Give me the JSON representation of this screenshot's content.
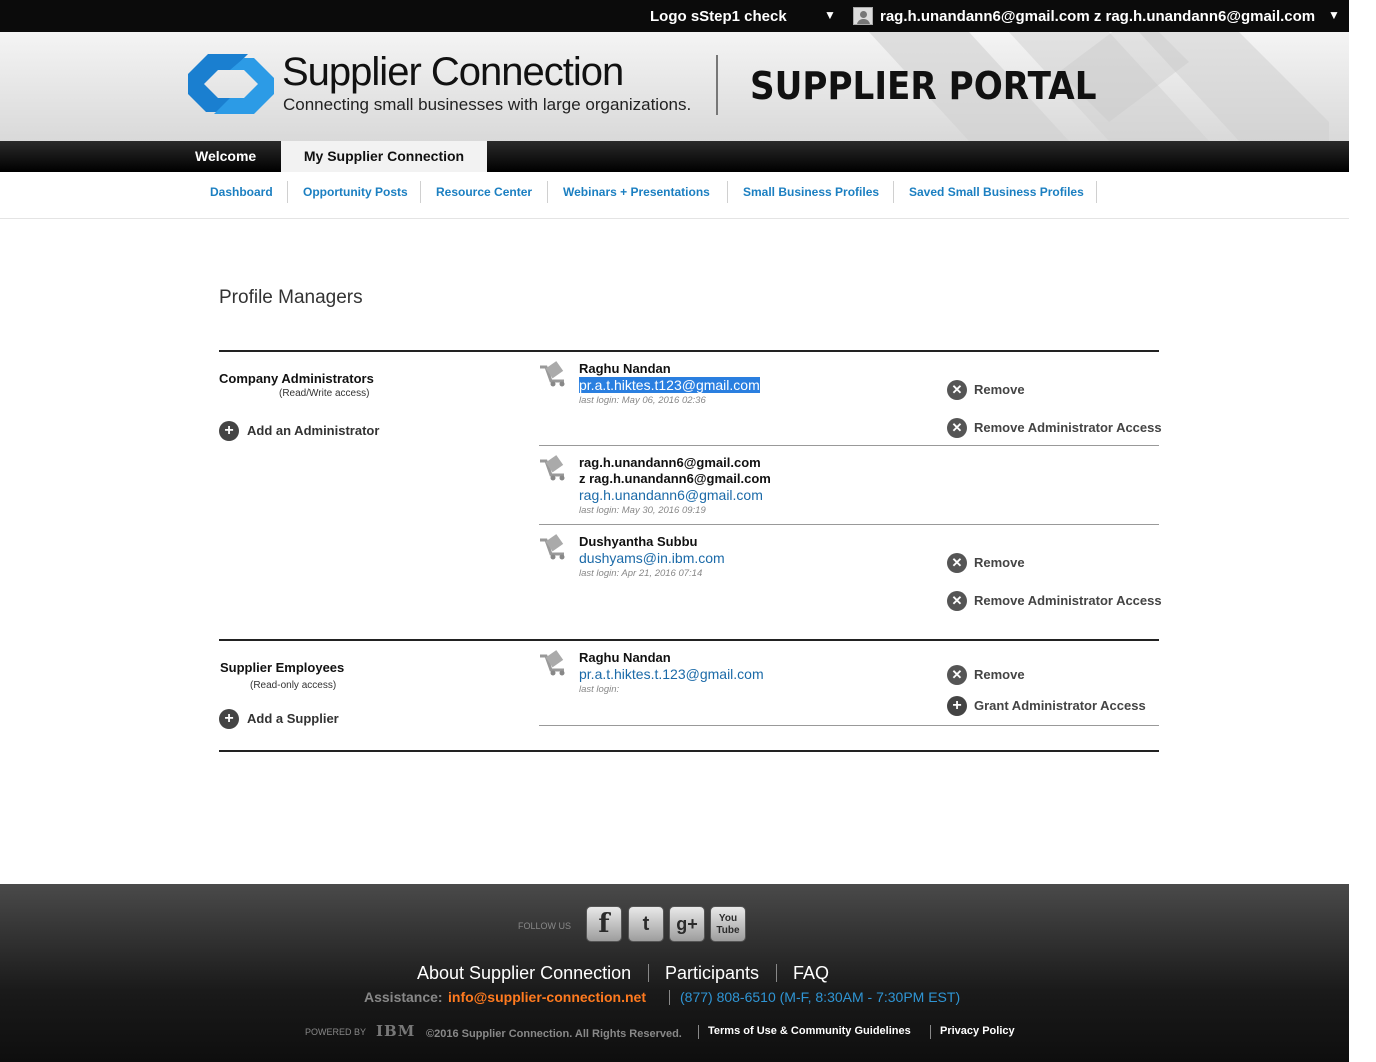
{
  "topbar": {
    "logo_link": "Logo  sStep1 check",
    "user_label": "rag.h.unandann6@gmail.com z rag.h.unandann6@gmail.com"
  },
  "header": {
    "brand_name": "Supplier Connection",
    "brand_tagline": "Connecting small businesses with large organizations.",
    "portal_title": "SUPPLIER PORTAL"
  },
  "tabs": [
    {
      "label": "Welcome"
    },
    {
      "label": "My Supplier Connection"
    }
  ],
  "subnav": [
    {
      "label": "Dashboard"
    },
    {
      "label": "Opportunity Posts"
    },
    {
      "label": "Resource Center"
    },
    {
      "label": "Webinars + Presentations"
    },
    {
      "label": "Small Business Profiles"
    },
    {
      "label": "Saved Small Business Profiles"
    }
  ],
  "page_title": "Profile Managers",
  "admins": {
    "heading": "Company Administrators",
    "sub": "(Read/Write access)",
    "add_label": "Add an Administrator",
    "people": [
      {
        "name": "Raghu Nandan",
        "email": "pr.a.t.hiktes.t123@gmail.com",
        "login": "last login: May 06, 2016 02:36"
      },
      {
        "name": "rag.h.unandann6@gmail.com",
        "name2": "z rag.h.unandann6@gmail.com",
        "email": "rag.h.unandann6@gmail.com",
        "login": "last login: May 30, 2016 09:19"
      },
      {
        "name": "Dushyantha Subbu",
        "email": "dushyams@in.ibm.com",
        "login": "last login: Apr 21, 2016 07:14"
      }
    ]
  },
  "employees": {
    "heading": "Supplier Employees",
    "sub": "(Read-only access)",
    "add_label": "Add a Supplier",
    "people": [
      {
        "name": "Raghu Nandan",
        "email": "pr.a.t.hiktes.t.123@gmail.com",
        "login": "last login:"
      }
    ]
  },
  "actions": {
    "remove": "Remove",
    "remove_admin": "Remove Administrator Access",
    "grant_admin": "Grant Administrator Access"
  },
  "footer": {
    "follow": "FOLLOW US",
    "social": [
      "f",
      "t",
      "g+",
      "You Tube"
    ],
    "links": [
      "About Supplier Connection",
      "Participants",
      "FAQ"
    ],
    "assist_label": "Assistance:",
    "assist_email": "info@supplier-connection.net",
    "assist_phone": "(877) 808-6510 (M-F, 8:30AM - 7:30PM EST)",
    "powered_by": "POWERED BY",
    "ibm": "IBM",
    "copyright": "©2016 Supplier Connection. All Rights Reserved.",
    "terms": "Terms of Use & Community Guidelines",
    "privacy": "Privacy Policy"
  }
}
